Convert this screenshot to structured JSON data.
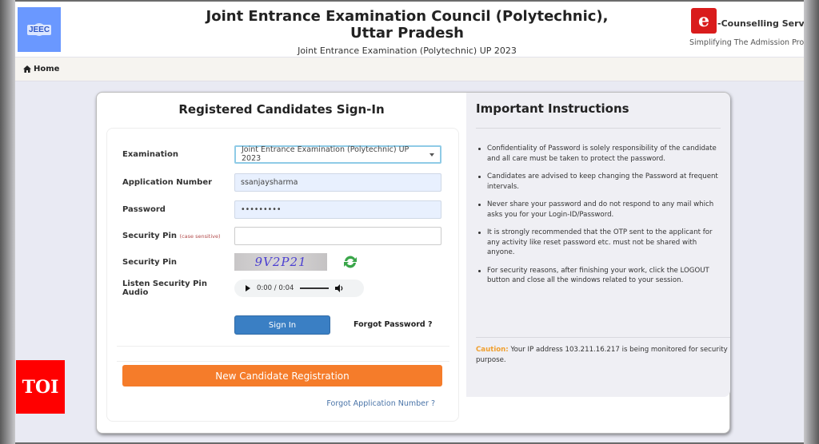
{
  "header": {
    "logo_left_text": "JEEC",
    "title": "Joint Entrance Examination Council (Polytechnic), Uttar Pradesh",
    "subtitle": "Joint Entrance Examination (Polytechnic) UP 2023",
    "brand_logo_glyph": "e",
    "brand_name": "-Counselling Services",
    "brand_tagline": "Simplifying The Admission Proce"
  },
  "nav": {
    "home_icon": "home-icon",
    "home_label": "Home"
  },
  "signin": {
    "title": "Registered Candidates Sign-In",
    "fields": {
      "examination_label": "Examination",
      "examination_value": "Joint Entrance Examination (Polytechnic) UP 2023",
      "application_label": "Application Number",
      "application_value": "ssanjaysharma",
      "password_label": "Password",
      "password_value": "•••••••••",
      "security_pin_label": "Security Pin",
      "security_pin_note": "(case sensitive)",
      "security_pin_value": "",
      "captcha_label": "Security Pin",
      "captcha_text": "9V2P21",
      "audio_label": "Listen Security Pin Audio",
      "audio_time": "0:00 / 0:04"
    },
    "signin_button": "Sign In",
    "forgot_password": "Forgot Password ?",
    "register_button": "New Candidate Registration",
    "forgot_application": "Forgot Application Number ?"
  },
  "instructions": {
    "title": "Important Instructions",
    "items": [
      "Confidentiality of Password is solely responsibility of the candidate and all care must be taken to protect the password.",
      "Candidates are advised to keep changing the Password at frequent intervals.",
      "Never share your password and do not respond to any mail which asks you for your Login-ID/Password.",
      "It is strongly recommended that the OTP sent to the applicant for any activity like reset password etc. must not be shared with anyone.",
      "For security reasons, after finishing your work, click the LOGOUT button and close all the windows related to your session."
    ],
    "caution_label": "Caution:",
    "caution_text": " Your IP address 103.211.16.217 is being monitored for security purpose."
  },
  "watermark": {
    "text": "TOI"
  },
  "colors": {
    "signin_button": "#3a7fc4",
    "register_button": "#f57c2a",
    "caution": "#f0a030",
    "watermark": "#ff0000"
  }
}
